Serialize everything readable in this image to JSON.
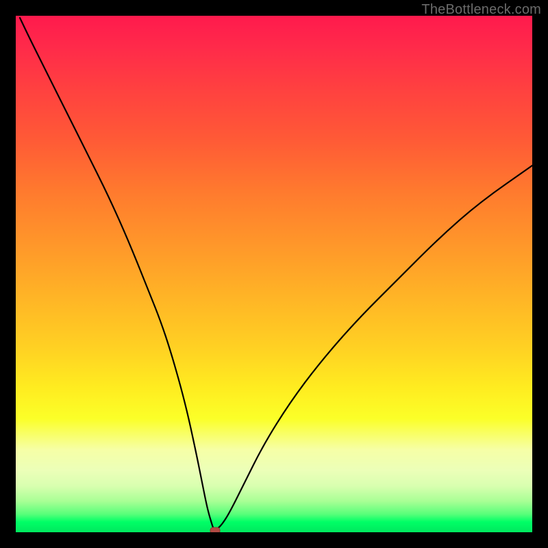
{
  "watermark": "TheBottleneck.com",
  "colors": {
    "background": "#000000",
    "curve": "#000000",
    "marker_fill": "#b24a44",
    "marker_stroke": "#8f3a35",
    "gradient_top": "#ff1a4d",
    "gradient_mid": "#ffd023",
    "gradient_bottom": "#00e85e"
  },
  "chart_data": {
    "type": "line",
    "title": "",
    "xlabel": "",
    "ylabel": "",
    "xlim": [
      0,
      100
    ],
    "ylim": [
      0,
      100
    ],
    "grid": false,
    "legend": false,
    "description": "V-shaped bottleneck curve over a vertical red-to-green gradient. The curve falls from the top-left corner to a cusp near the bottom, then rises to the right edge at roughly 70% height. A small rounded marker sits at the cusp.",
    "series": [
      {
        "name": "bottleneck_curve",
        "x": [
          0.8,
          3,
          6,
          10,
          14,
          18,
          22,
          26,
          28,
          30,
          32,
          33.5,
          35,
          36,
          36.8,
          37.4,
          37.9,
          38.3,
          39.0,
          40.0,
          41.5,
          44,
          48,
          53,
          59,
          66,
          74,
          82,
          90,
          100
        ],
        "y": [
          99.6,
          95,
          89,
          81,
          73,
          65,
          56,
          46,
          41,
          35,
          28,
          22,
          15,
          10,
          6,
          3.5,
          1.8,
          0.6,
          0.6,
          1.6,
          4.0,
          9,
          17,
          25,
          33,
          41,
          49,
          57,
          64,
          71
        ]
      }
    ],
    "annotations": [
      {
        "name": "cusp_marker",
        "x": 38.6,
        "y": 0.4,
        "shape": "rounded-rect",
        "color": "#b24a44"
      }
    ]
  }
}
